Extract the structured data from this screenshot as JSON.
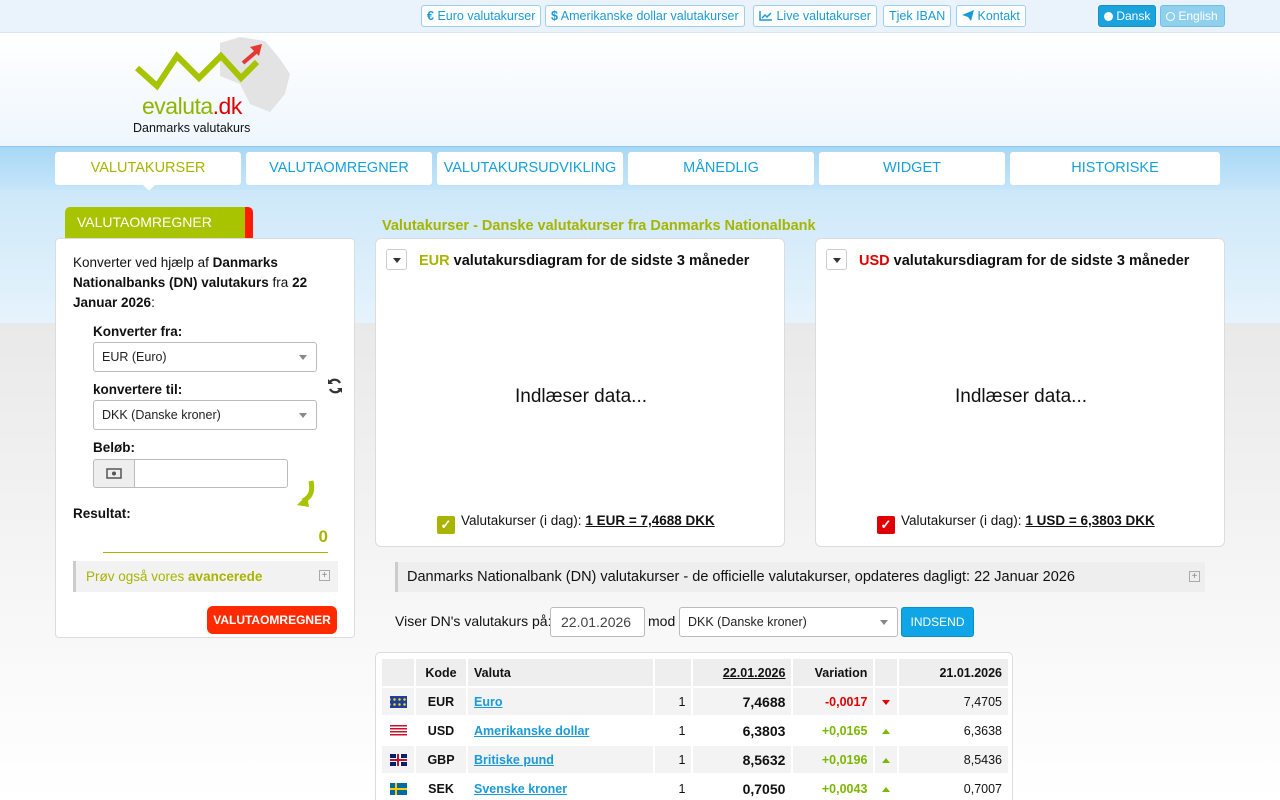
{
  "topbar": {
    "links": [
      {
        "icon": "euro-icon",
        "label": "Euro valutakurser"
      },
      {
        "icon": "dollar-icon",
        "label": "Amerikanske dollar valutakurser"
      },
      {
        "icon": "line-chart-icon",
        "label": "Live valutakurser"
      },
      {
        "label": "Tjek IBAN"
      },
      {
        "icon": "paper-plane-icon",
        "label": "Kontakt"
      }
    ],
    "lang": [
      {
        "label": "Dansk",
        "active": true
      },
      {
        "label": "English",
        "active": false
      }
    ]
  },
  "logo": {
    "brand_a": "evaluta",
    "brand_b": ".dk",
    "tagline": "Danmarks valutakurs"
  },
  "nav": [
    "VALUTAKURSER",
    "VALUTAOMREGNER",
    "VALUTAKURSUDVIKLING",
    "MÅNEDLIG",
    "WIDGET",
    "HISTORISKE"
  ],
  "converter": {
    "tab": "VALUTAOMREGNER",
    "intro": {
      "a": "Konverter ved hjælp af ",
      "b": "Danmarks Nationalbanks (DN) valutakurs",
      "c": " fra ",
      "d": "22 Januar 2026",
      "e": ":"
    },
    "from_label": "Konverter fra:",
    "from_value": "EUR (Euro)",
    "to_label": "konvertere til:",
    "to_value": "DKK (Danske kroner)",
    "amount_label": "Beløb:",
    "amount_value": "",
    "result_label": "Resultat:",
    "result_value": "0",
    "advanced": {
      "a": "Prøv også vores ",
      "b": "avancerede"
    },
    "button": "VALUTAOMREGNER"
  },
  "main": {
    "heading": "Valutakurser - Danske valutakurser fra Danmarks Nationalbank",
    "charts": [
      {
        "code": "EUR",
        "title": "valutakursdiagram for de sidste 3 måneder",
        "loading": "Indlæser data...",
        "today_label": "Valutakurser (i dag):",
        "today_value": "1 EUR = 7,4688 DKK",
        "color": "#a8b400"
      },
      {
        "code": "USD",
        "title": "valutakursdiagram for de sidste 3 måneder",
        "loading": "Indlæser data...",
        "today_label": "Valutakurser (i dag):",
        "today_value": "1 USD = 6,3803 DKK",
        "color": "#e00000"
      }
    ],
    "dn_title": "Danmarks Nationalbank (DN) valutakurser - de officielle valutakurser, opdateres dagligt: 22 Januar 2026",
    "showing_label": "Viser DN's valutakurs på:",
    "date_value": "22.01.2026",
    "mod": "mod",
    "against_value": "DKK (Danske kroner)",
    "submit": "INDSEND"
  },
  "table": {
    "headers": [
      "",
      "Kode",
      "Valuta",
      "",
      "22.01.2026",
      "Variation",
      "",
      "21.01.2026"
    ],
    "rows": [
      {
        "flag": "eu",
        "code": "EUR",
        "name": "Euro",
        "unit": "1",
        "rate": "7,4688",
        "var": "-0,0017",
        "dir": "down",
        "prev": "7,4705"
      },
      {
        "flag": "us",
        "code": "USD",
        "name": "Amerikanske dollar",
        "unit": "1",
        "rate": "6,3803",
        "var": "+0,0165",
        "dir": "up",
        "prev": "6,3638"
      },
      {
        "flag": "gb",
        "code": "GBP",
        "name": "Britiske pund",
        "unit": "1",
        "rate": "8,5632",
        "var": "+0,0196",
        "dir": "up",
        "prev": "8,5436"
      },
      {
        "flag": "se",
        "code": "SEK",
        "name": "Svenske kroner",
        "unit": "1",
        "rate": "0,7050",
        "var": "+0,0043",
        "dir": "up",
        "prev": "0,7007"
      }
    ]
  }
}
